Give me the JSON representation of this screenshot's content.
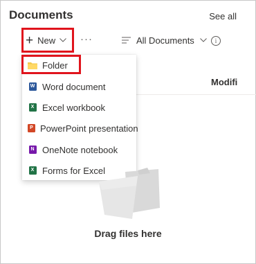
{
  "header": {
    "title": "Documents",
    "see_all": "See all"
  },
  "toolbar": {
    "new_label": "New",
    "more_label": "···",
    "view_label": "All Documents",
    "info_label": "i"
  },
  "list": {
    "column_modified": "Modifi"
  },
  "new_menu": {
    "items": [
      {
        "label": "Folder",
        "icon": "folder-icon",
        "color": "#f2c94c"
      },
      {
        "label": "Word document",
        "icon": "word-icon",
        "color": "#2b579a",
        "letter": "W"
      },
      {
        "label": "Excel workbook",
        "icon": "excel-icon",
        "color": "#217346",
        "letter": "X"
      },
      {
        "label": "PowerPoint presentation",
        "icon": "powerpoint-icon",
        "color": "#d24726",
        "letter": "P"
      },
      {
        "label": "OneNote notebook",
        "icon": "onenote-icon",
        "color": "#7719aa",
        "letter": "N"
      },
      {
        "label": "Forms for Excel",
        "icon": "forms-excel-icon",
        "color": "#217346",
        "letter": "X"
      }
    ]
  },
  "empty_state": {
    "message": "Drag files here"
  },
  "colors": {
    "highlight": "#e0141c",
    "text": "#323130"
  }
}
